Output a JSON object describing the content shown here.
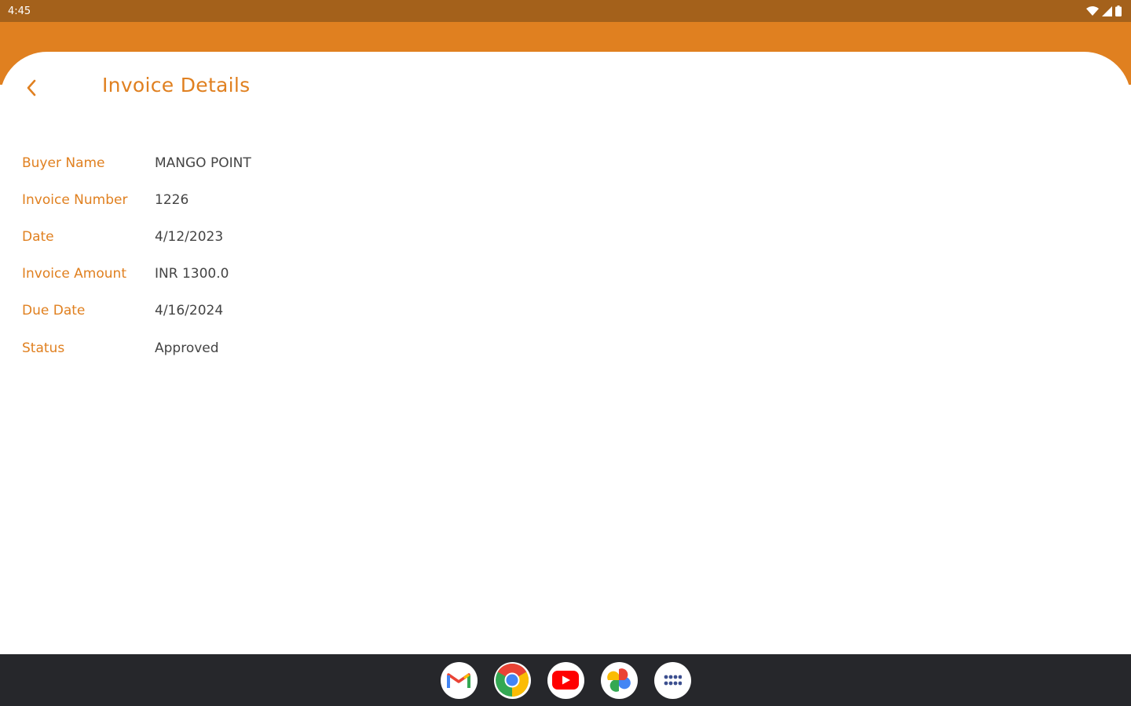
{
  "status_bar": {
    "time": "4:45"
  },
  "header": {
    "title": "Invoice Details",
    "back_icon": "chevron-left-icon"
  },
  "details": [
    {
      "label": "Buyer Name",
      "value": "MANGO POINT"
    },
    {
      "label": "Invoice Number",
      "value": "1226"
    },
    {
      "label": "Date",
      "value": "4/12/2023"
    },
    {
      "label": "Invoice Amount",
      "value": "INR 1300.0"
    },
    {
      "label": "Due Date",
      "value": "4/16/2024"
    },
    {
      "label": "Status",
      "value": "Approved"
    }
  ],
  "dock": [
    "gmail-icon",
    "chrome-icon",
    "youtube-icon",
    "photos-icon",
    "app-drawer-icon"
  ],
  "colors": {
    "accent": "#e08020",
    "status_bar": "#a4611b",
    "nav_bar": "#26272b",
    "value_text": "#444444"
  }
}
